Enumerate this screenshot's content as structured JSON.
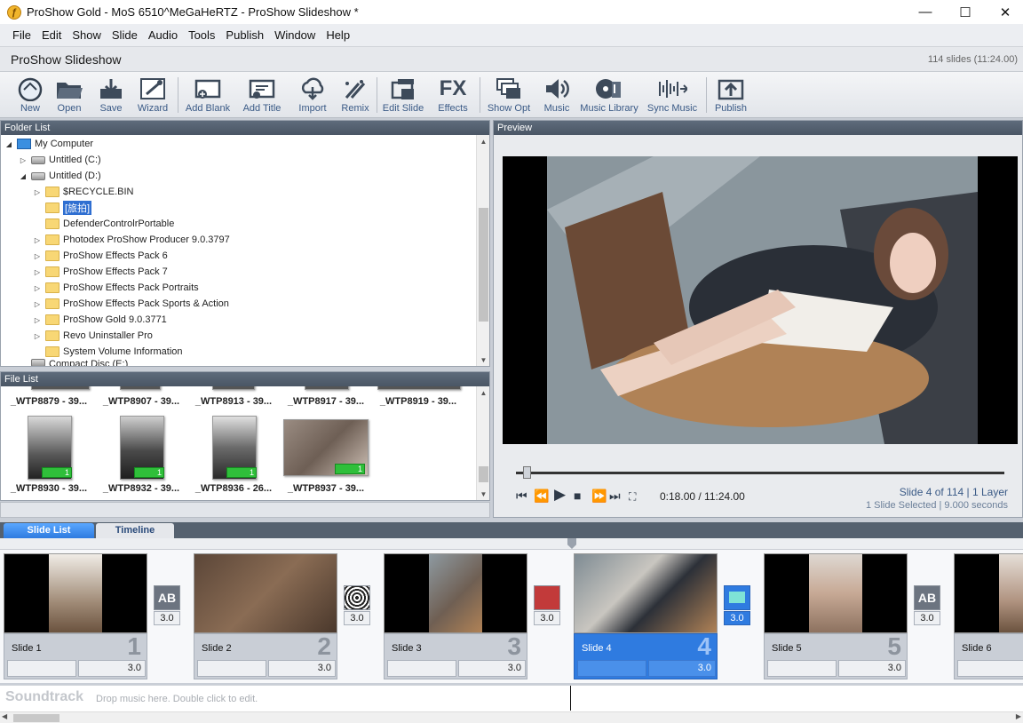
{
  "window": {
    "title": "ProShow Gold - MoS 6510^MeGaHeRTZ - ProShow Slideshow *",
    "minimize": "—",
    "maximize": "☐",
    "close": "✕"
  },
  "menu": [
    "File",
    "Edit",
    "Show",
    "Slide",
    "Audio",
    "Tools",
    "Publish",
    "Window",
    "Help"
  ],
  "show": {
    "title": "ProShow Slideshow",
    "count": "114 slides (11:24.00)"
  },
  "toolbar": [
    {
      "label": "New",
      "icon": "new-show-icon"
    },
    {
      "label": "Open",
      "icon": "open-folder-icon"
    },
    {
      "label": "Save",
      "icon": "save-icon"
    },
    {
      "label": "Wizard",
      "icon": "wizard-icon"
    },
    {
      "label": "Add Blank",
      "icon": "add-blank-icon"
    },
    {
      "label": "Add Title",
      "icon": "add-title-icon"
    },
    {
      "label": "Import",
      "icon": "import-icon"
    },
    {
      "label": "Remix",
      "icon": "remix-icon"
    },
    {
      "label": "Edit Slide",
      "icon": "edit-slide-icon"
    },
    {
      "label": "Effects",
      "icon": "fx-effects-icon"
    },
    {
      "label": "Show Opt",
      "icon": "show-options-icon"
    },
    {
      "label": "Music",
      "icon": "music-speaker-icon"
    },
    {
      "label": "Music Library",
      "icon": "music-library-icon"
    },
    {
      "label": "Sync Music",
      "icon": "sync-music-icon"
    },
    {
      "label": "Publish",
      "icon": "publish-icon"
    }
  ],
  "folder_panel": {
    "header": "Folder List",
    "items": [
      {
        "label": "My Computer",
        "type": "pc",
        "expanded": true
      },
      {
        "label": "Untitled (C:)",
        "type": "drive",
        "expanded": false
      },
      {
        "label": "Untitled (D:)",
        "type": "drive",
        "expanded": true
      },
      {
        "label": "$RECYCLE.BIN",
        "type": "folder",
        "expanded": false
      },
      {
        "label": "[旅拍]",
        "type": "folder",
        "selected": true
      },
      {
        "label": "DefenderControlrPortable",
        "type": "folder"
      },
      {
        "label": "Photodex ProShow Producer 9.0.3797",
        "type": "folder",
        "expanded": false
      },
      {
        "label": "ProShow Effects Pack 6",
        "type": "folder",
        "expanded": false
      },
      {
        "label": "ProShow Effects Pack 7",
        "type": "folder",
        "expanded": false
      },
      {
        "label": "ProShow Effects Pack Portraits",
        "type": "folder",
        "expanded": false
      },
      {
        "label": "ProShow Effects Pack Sports & Action",
        "type": "folder",
        "expanded": false
      },
      {
        "label": "ProShow Gold 9.0.3771",
        "type": "folder",
        "expanded": false
      },
      {
        "label": "Revo Uninstaller Pro",
        "type": "folder",
        "expanded": false
      },
      {
        "label": "System Volume Information",
        "type": "folder"
      },
      {
        "label": "Compact Disc (E:)",
        "type": "drive"
      }
    ]
  },
  "file_panel": {
    "header": "File List",
    "row1": [
      "_WTP8879 - 39...",
      "_WTP8907 - 39...",
      "_WTP8913 - 39...",
      "_WTP8917 - 39...",
      "_WTP8919 - 39..."
    ],
    "row2": [
      {
        "name": "_WTP8930 - 39...",
        "uses": "1"
      },
      {
        "name": "_WTP8932 - 39...",
        "uses": "1"
      },
      {
        "name": "_WTP8936 - 26...",
        "uses": "1"
      },
      {
        "name": "_WTP8937 - 39...",
        "uses": "1"
      }
    ]
  },
  "preview": {
    "header": "Preview",
    "time": "0:18.00 / 11:24.00",
    "slide_info": "Slide 4 of 114  |  1 Layer",
    "slide_sub": "1 Slide Selected  |  9.000 seconds",
    "progress": 0.026
  },
  "tabs": {
    "slide_list": "Slide List",
    "timeline": "Timeline"
  },
  "slides": [
    {
      "name": "Slide 1",
      "num": "1",
      "duration": "3.0"
    },
    {
      "name": "Slide 2",
      "num": "2",
      "duration": "3.0"
    },
    {
      "name": "Slide 3",
      "num": "3",
      "duration": "3.0"
    },
    {
      "name": "Slide 4",
      "num": "4",
      "duration": "3.0",
      "selected": true
    },
    {
      "name": "Slide 5",
      "num": "5",
      "duration": "3.0"
    },
    {
      "name": "Slide 6",
      "num": "6",
      "duration": ""
    }
  ],
  "transitions": [
    {
      "value": "3.0",
      "icon": "ab-transition-icon"
    },
    {
      "value": "3.0",
      "icon": "ripple-transition-icon"
    },
    {
      "value": "3.0",
      "icon": "circle-transition-icon"
    },
    {
      "value": "3.0",
      "icon": "slide-transition-icon",
      "selected": true
    },
    {
      "value": "3.0",
      "icon": "ab-transition-icon"
    }
  ],
  "soundtrack": {
    "label": "Soundtrack",
    "hint": "Drop music here.  Double click to edit."
  }
}
